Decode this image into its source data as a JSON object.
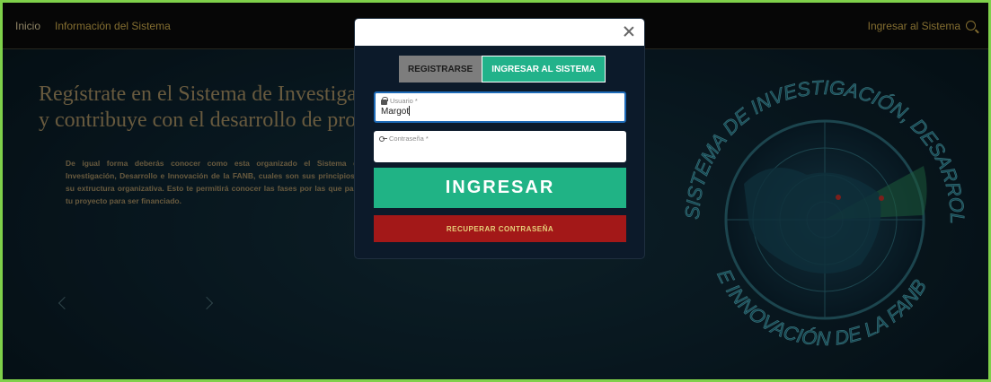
{
  "nav": {
    "home": "Inicio",
    "info": "Información del Sistema",
    "login": "Ingresar al Sistema"
  },
  "hero": {
    "line1": "Regístrate en el Sistema de Investigación, Desarrollo e Innovación",
    "line2": "y contribuye con el desarrollo de proyectos para la Fuerza Armada",
    "body": "De igual forma deberás conocer como esta organizado el Sistema de Investigación, Desarrollo e Innovación de la FANB, cuales son sus principios y su extructura organizativa. Esto te permitirá conocer las fases por las que pasa tu proyecto para ser financiado."
  },
  "emblem": {
    "top_text": "SISTEMA DE INVESTIGACIÓN, DESARROLLO",
    "bottom_text": "E INNOVACIÓN DE LA FANB"
  },
  "modal": {
    "tab_register": "REGISTRARSE",
    "tab_login": "INGRESAR AL SISTEMA",
    "user_label": "Usuario *",
    "user_value": "Margot",
    "pass_label": "Contraseña *",
    "submit": "INGRESAR",
    "recover": "RECUPERAR CONTRASEÑA"
  },
  "colors": {
    "accent_green": "#20b385",
    "danger_red": "#a31818",
    "nav_gold": "#c9a84a"
  }
}
